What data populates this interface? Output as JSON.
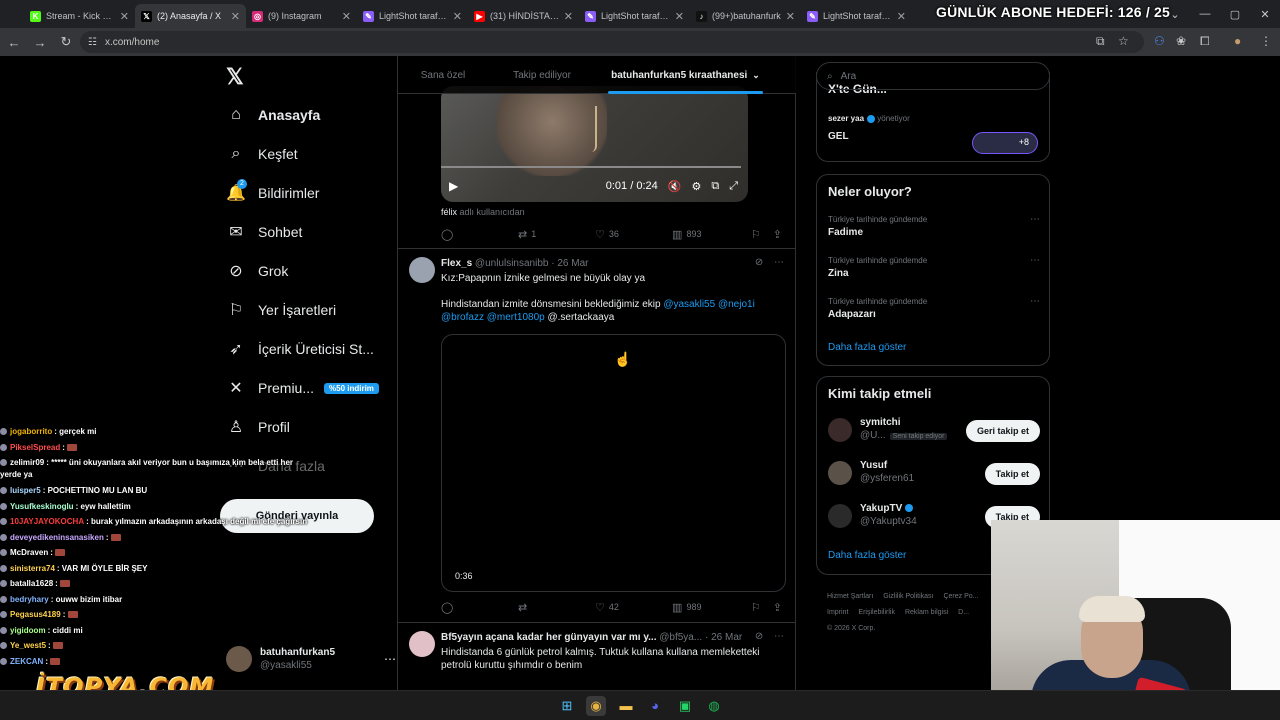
{
  "browser": {
    "tabs": [
      {
        "title": "Stream - Kick Das",
        "color": "#53fc18",
        "glyph": "K"
      },
      {
        "title": "(2) Anasayfa / X",
        "color": "#000000",
        "glyph": "𝕏"
      },
      {
        "title": "(9) Instagram",
        "color": "#d62976",
        "glyph": "◎"
      },
      {
        "title": "LightShot tarafından",
        "color": "#8b5cf6",
        "glyph": "✎"
      },
      {
        "title": "(31) HİNDİSTAN İ",
        "color": "#ff0000",
        "glyph": "▶"
      },
      {
        "title": "LightShot tarafından",
        "color": "#8b5cf6",
        "glyph": "✎"
      },
      {
        "title": "(99+)batuhanfurk",
        "color": "#111111",
        "glyph": "♪"
      },
      {
        "title": "LightShot tarafından",
        "color": "#8b5cf6",
        "glyph": "✎"
      }
    ],
    "url": "x.com/home"
  },
  "overlay": {
    "goal": "GÜNLÜK ABONE HEDEFİ: 126 / 25",
    "brand": "İTOPYA.COM"
  },
  "nav": {
    "items": [
      {
        "label": "Anasayfa",
        "icon": "home-icon",
        "glyph": "⌂"
      },
      {
        "label": "Keşfet",
        "icon": "search-icon",
        "glyph": "⌕"
      },
      {
        "label": "Bildirimler",
        "icon": "bell-icon",
        "glyph": "🔔",
        "badge": "2"
      },
      {
        "label": "Sohbet",
        "icon": "mail-icon",
        "glyph": "✉"
      },
      {
        "label": "Grok",
        "icon": "grok-icon",
        "glyph": "⊘"
      },
      {
        "label": "Yer İşaretleri",
        "icon": "bookmark-icon",
        "glyph": "⚐"
      },
      {
        "label": "İçerik Üreticisi St...",
        "icon": "rocket-icon",
        "glyph": "➶"
      },
      {
        "label": "Premiu...",
        "icon": "x-premium-icon",
        "glyph": "✕",
        "promo": "%50 indirim"
      },
      {
        "label": "Profil",
        "icon": "person-icon",
        "glyph": "♙"
      },
      {
        "label": "Daha fazla",
        "icon": "more-icon",
        "glyph": "⋯"
      }
    ],
    "post_button": "Gönderi yayınla",
    "account": {
      "name": "batuhanfurkan5",
      "handle": "@yasakli55"
    }
  },
  "feed": {
    "tabs": [
      "Sana özel",
      "Takip ediliyor",
      "batuhanfurkan5 kıraathanesi"
    ],
    "tweet1": {
      "video_time": "0:01 / 0:24",
      "source_user": "félix",
      "source_suffix": "adlı kullanıcıdan",
      "replies": "",
      "retweets": "1",
      "likes": "36",
      "views": "893"
    },
    "tweet2": {
      "name": "Flex_s",
      "handle": "@unlulsinsanibb",
      "date": "· 26 Mar",
      "line1": "Kız:Papapnın İznike gelmesi ne büyük olay ya",
      "line2": "Hindistandan izmite dönsmesini beklediğimiz ekip",
      "mentions": [
        "@yasakli55",
        "@nejo1i",
        "@brofazz",
        "@mert1080p"
      ],
      "tail": "@.sertackaaya",
      "video_duration": "0:36",
      "replies": "",
      "retweets": "",
      "likes": "42",
      "views": "989"
    },
    "tweet3": {
      "name": "Bf5yayın açana kadar her günyayın var mı y...",
      "handle": "@bf5ya...",
      "date": "· 26 Mar",
      "text": "Hindistanda 6 günlük petrol kalmış. Tuktuk kullana kullana memleketteki petrolü kuruttu şıhımdır o benim"
    }
  },
  "sidebar": {
    "search_placeholder": "Ara",
    "community": {
      "title": "X'te Gün...",
      "user": "sezer yaa",
      "role": "yönetiyor",
      "name": "GEL",
      "more": "+8"
    },
    "trends_title": "Neler oluyor?",
    "trends": [
      {
        "context": "Türkiye tarihinde gündemde",
        "name": "Fadime"
      },
      {
        "context": "Türkiye tarihinde gündemde",
        "name": "Zina"
      },
      {
        "context": "Türkiye tarihinde gündemde",
        "name": "Adapazarı"
      }
    ],
    "show_more": "Daha fazla göster",
    "who_title": "Kimi takip etmeli",
    "who": [
      {
        "name": "symitchi",
        "handle": "@U...",
        "tag": "Seni takip ediyor",
        "button": "Geri takip et",
        "color": "#3a2a2a"
      },
      {
        "name": "Yusuf",
        "handle": "@ysferen61",
        "tag": "",
        "button": "Takip et",
        "color": "#5a5148"
      },
      {
        "name": "YakupTV",
        "handle": "@Yakuptv34",
        "tag": "",
        "button": "Takip et",
        "color": "#2a2a2a"
      }
    ],
    "who_more": "Daha fazla göster",
    "footer": [
      "Hizmet Şartları",
      "Gizlilik Politikası",
      "Çerez Po...",
      "Imprint",
      "Erişilebilirlik",
      "Reklam bilgisi",
      "D...",
      "© 2026 X Corp."
    ]
  },
  "chat": [
    {
      "user": "jogaborrito",
      "color": "#f0b400",
      "msg": ": gerçek mi",
      "emote": false
    },
    {
      "user": "PikselSpread",
      "color": "#ff4d4d",
      "msg": ":",
      "emote": true
    },
    {
      "user": "zelimir09",
      "color": "#ffffff",
      "msg": ": ***** üni okuyanlara akıl veriyor bun u başımıza kim bela etti her yerde ya",
      "emote": false,
      "wrap": true
    },
    {
      "user": "luisper5",
      "color": "#a8d8ff",
      "msg": ": POCHETTINO MU LAN BU",
      "emote": false
    },
    {
      "user": "Yusufkeskinoglu",
      "color": "#a8ffd0",
      "msg": ": eyw hallettim",
      "emote": false
    },
    {
      "user": "10JAYJAYOKOCHA",
      "color": "#ff3b3b",
      "msg": ": burak yılmazın arkadaşının arkadaşı değil mi efe çağırsın",
      "emote": false
    },
    {
      "user": "deveyedikeninsanasiken",
      "color": "#c9a8ff",
      "msg": ":",
      "emote": true
    },
    {
      "user": "McDraven",
      "color": "#ffffff",
      "msg": ":",
      "emote": true
    },
    {
      "user": "sinisterra74",
      "color": "#ffd24d",
      "msg": ": VAR MI ÖYLE BİR ŞEY",
      "emote": false
    },
    {
      "user": "batalla1628",
      "color": "#ffffff",
      "msg": ":",
      "emote": true
    },
    {
      "user": "bedryhary",
      "color": "#7fb3ff",
      "msg": ": ouww bizim itibar",
      "emote": false
    },
    {
      "user": "Pegasus4189",
      "color": "#ffd24d",
      "msg": ":",
      "emote": true
    },
    {
      "user": "yigidoom",
      "color": "#a8ff8a",
      "msg": ": ciddi mi",
      "emote": false
    },
    {
      "user": "Ye_west5",
      "color": "#ffd24d",
      "msg": ":",
      "emote": true
    },
    {
      "user": "ZEKCAN",
      "color": "#7fb3ff",
      "msg": ":",
      "emote": true
    }
  ]
}
